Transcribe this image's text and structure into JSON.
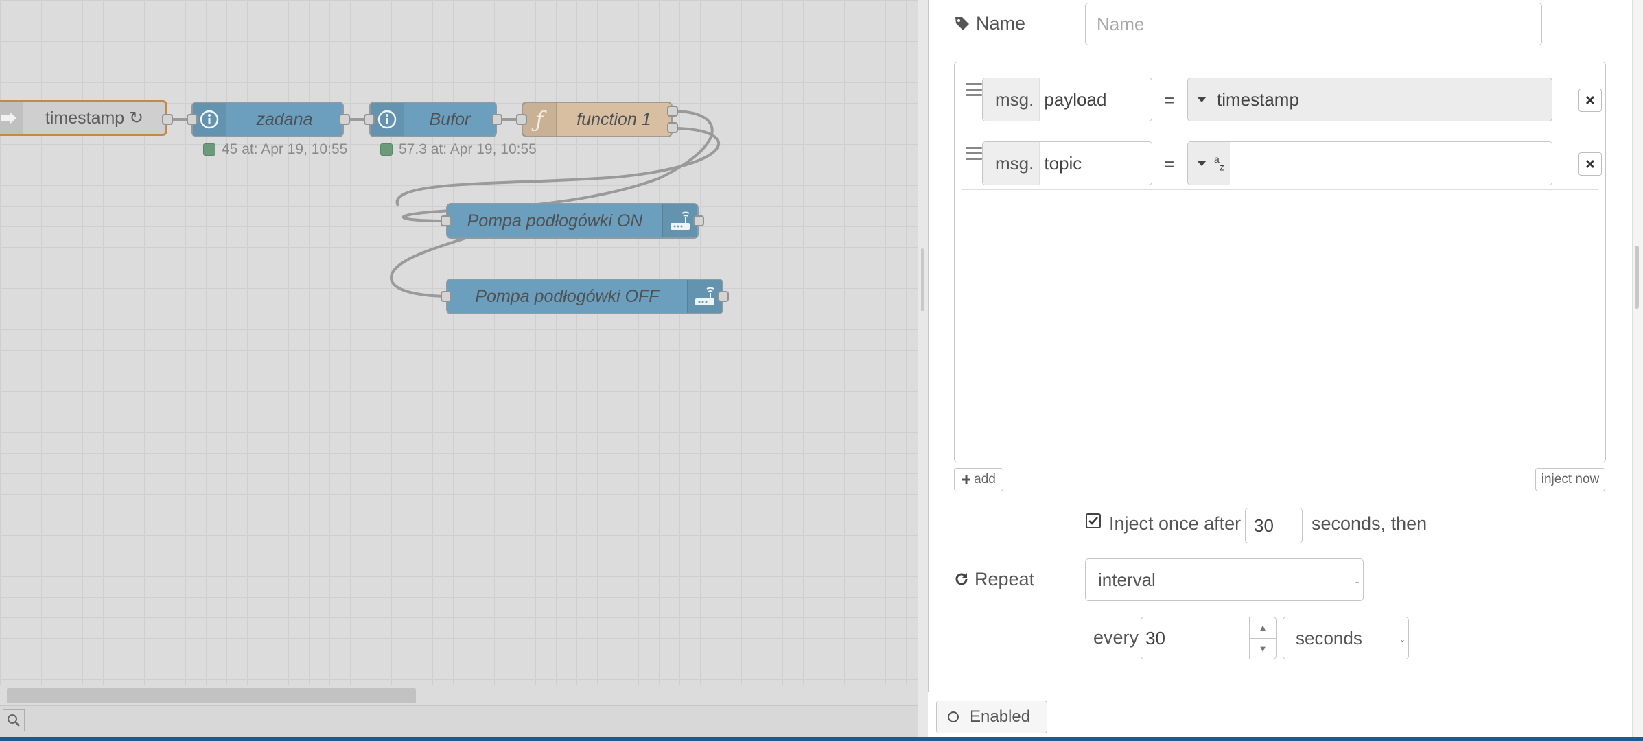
{
  "canvas": {
    "nodes": {
      "timestamp": {
        "label": "timestamp ↻"
      },
      "zadana": {
        "label": "zadana",
        "status": "45 at: Apr 19, 10:55"
      },
      "bufor": {
        "label": "Bufor",
        "status": "57.3 at: Apr 19, 10:55"
      },
      "function1": {
        "label": "function 1"
      },
      "pompa_on": {
        "label": "Pompa podłogówki ON"
      },
      "pompa_off": {
        "label": "Pompa podłogówki OFF"
      }
    }
  },
  "editor": {
    "name": {
      "label": "Name",
      "placeholder": "Name",
      "value": ""
    },
    "properties": [
      {
        "prefix": "msg.",
        "property": "payload",
        "equals": "=",
        "type_label": "timestamp"
      },
      {
        "prefix": "msg.",
        "property": "topic",
        "equals": "=",
        "type_label": "",
        "type_icon": "az"
      }
    ],
    "add_button": "add",
    "inject_now_button": "inject now",
    "inject_once": {
      "checked": true,
      "label": "Inject once after",
      "value": "30",
      "suffix": "seconds, then"
    },
    "repeat": {
      "label": "Repeat",
      "mode": "interval",
      "every_label": "every",
      "every_value": "30",
      "unit": "seconds"
    },
    "enabled_label": "Enabled"
  },
  "colors": {
    "node_blue": "#6b9fbd",
    "node_function": "#d9bfa2",
    "inject_border": "#c3884a",
    "status_green": "#6c9a7b"
  }
}
